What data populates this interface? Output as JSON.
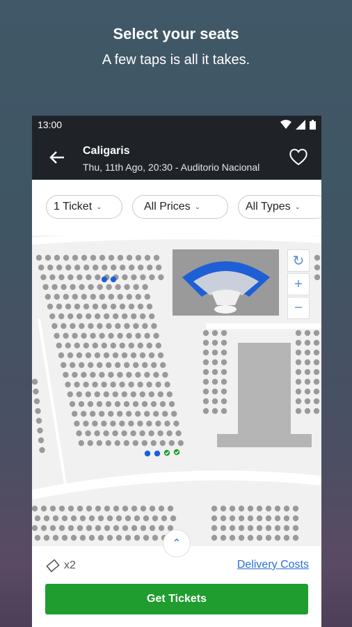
{
  "promo": {
    "title": "Select your seats",
    "subtitle": "A few taps is all it takes."
  },
  "statusbar": {
    "time": "13:00",
    "icons": [
      "wifi-icon",
      "signal-icon",
      "battery-icon"
    ]
  },
  "appbar": {
    "title": "Caligaris",
    "subtitle": "Thu, 11th Ago, 20:30 - Auditorio Nacional",
    "back_icon": "arrow-left-icon",
    "favorite_icon": "heart-outline-icon"
  },
  "filters": [
    {
      "label": "1 Ticket"
    },
    {
      "label": "All Prices"
    },
    {
      "label": "All Types"
    }
  ],
  "map": {
    "controls": [
      "refresh-icon",
      "zoom-in-icon",
      "zoom-out-icon"
    ],
    "expand_icon": "chevron-up-icon",
    "colors": {
      "available": "#9a9a9a",
      "selected_blue": "#1f5fd6",
      "selected_green": "#1f9d2f"
    }
  },
  "footer": {
    "ticket_count": "x2",
    "delivery_label": "Delivery Costs",
    "cta_label": "Get Tickets"
  },
  "colors": {
    "appbar_bg": "#1f2328",
    "cta_bg": "#1f9d2f",
    "link": "#2a6fd6"
  }
}
